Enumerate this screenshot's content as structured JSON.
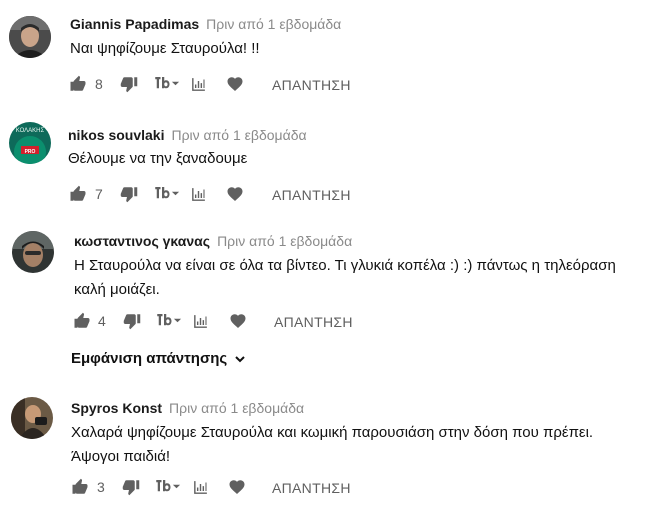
{
  "comments": [
    {
      "author": "Giannis Papadimas",
      "time": "Πριν από 1 εβδομάδα",
      "lines": [
        "Ναι ψηφίζουμε Σταυρούλα! !!"
      ],
      "likes": "8",
      "reply_label": "ΑΠΑΝΤΗΣΗ"
    },
    {
      "author": "nikos souvlaki",
      "time": "Πριν από 1 εβδομάδα",
      "lines": [
        "Θέλουμε να την ξαναδουμε"
      ],
      "likes": "7",
      "reply_label": "ΑΠΑΝΤΗΣΗ"
    },
    {
      "author": "κωσταντινος γκανας",
      "time": "Πριν από 1 εβδομάδα",
      "lines": [
        "Η Σταυρούλα να είναι σε όλα τα βίντεο. Τι γλυκιά κοπέλα :) :) πάντως η τηλεόραση",
        "καλή μοιάζει."
      ],
      "likes": "4",
      "reply_label": "ΑΠΑΝΤΗΣΗ",
      "show_replies": "Εμφάνιση απάντησης"
    },
    {
      "author": "Spyros Konst",
      "time": "Πριν από 1 εβδομάδα",
      "lines": [
        "Χαλαρά ψηφίζουμε Σταυρούλα και κωμική παρουσιάση στην δόση που πρέπει.",
        "Άψογοι παιδιά!"
      ],
      "likes": "3",
      "reply_label": "ΑΠΑΝΤΗΣΗ"
    }
  ],
  "avatars": {
    "c2_overlay_text": "ΚΟΛΑΚΗΣ",
    "c2_overlay_text2": "PRO"
  },
  "colors": {
    "icon": "#606060",
    "author": "#1b1b1b",
    "time": "#8a8a8a",
    "avatar2_bg": "#0e6a5a"
  },
  "icons": [
    "thumb-up-icon",
    "thumb-down-icon",
    "youtube-brand-icon",
    "chevron-down-icon",
    "stats-icon",
    "heart-icon"
  ]
}
